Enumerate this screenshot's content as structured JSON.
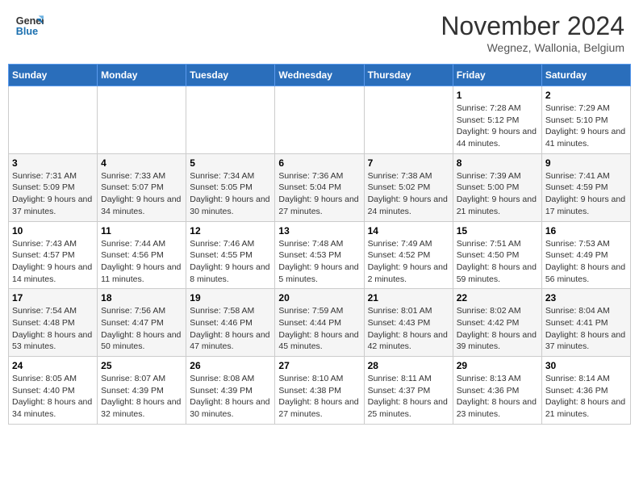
{
  "logo": {
    "line1": "General",
    "line2": "Blue"
  },
  "title": "November 2024",
  "location": "Wegnez, Wallonia, Belgium",
  "days_of_week": [
    "Sunday",
    "Monday",
    "Tuesday",
    "Wednesday",
    "Thursday",
    "Friday",
    "Saturday"
  ],
  "weeks": [
    [
      {
        "day": "",
        "info": ""
      },
      {
        "day": "",
        "info": ""
      },
      {
        "day": "",
        "info": ""
      },
      {
        "day": "",
        "info": ""
      },
      {
        "day": "",
        "info": ""
      },
      {
        "day": "1",
        "info": "Sunrise: 7:28 AM\nSunset: 5:12 PM\nDaylight: 9 hours and 44 minutes."
      },
      {
        "day": "2",
        "info": "Sunrise: 7:29 AM\nSunset: 5:10 PM\nDaylight: 9 hours and 41 minutes."
      }
    ],
    [
      {
        "day": "3",
        "info": "Sunrise: 7:31 AM\nSunset: 5:09 PM\nDaylight: 9 hours and 37 minutes."
      },
      {
        "day": "4",
        "info": "Sunrise: 7:33 AM\nSunset: 5:07 PM\nDaylight: 9 hours and 34 minutes."
      },
      {
        "day": "5",
        "info": "Sunrise: 7:34 AM\nSunset: 5:05 PM\nDaylight: 9 hours and 30 minutes."
      },
      {
        "day": "6",
        "info": "Sunrise: 7:36 AM\nSunset: 5:04 PM\nDaylight: 9 hours and 27 minutes."
      },
      {
        "day": "7",
        "info": "Sunrise: 7:38 AM\nSunset: 5:02 PM\nDaylight: 9 hours and 24 minutes."
      },
      {
        "day": "8",
        "info": "Sunrise: 7:39 AM\nSunset: 5:00 PM\nDaylight: 9 hours and 21 minutes."
      },
      {
        "day": "9",
        "info": "Sunrise: 7:41 AM\nSunset: 4:59 PM\nDaylight: 9 hours and 17 minutes."
      }
    ],
    [
      {
        "day": "10",
        "info": "Sunrise: 7:43 AM\nSunset: 4:57 PM\nDaylight: 9 hours and 14 minutes."
      },
      {
        "day": "11",
        "info": "Sunrise: 7:44 AM\nSunset: 4:56 PM\nDaylight: 9 hours and 11 minutes."
      },
      {
        "day": "12",
        "info": "Sunrise: 7:46 AM\nSunset: 4:55 PM\nDaylight: 9 hours and 8 minutes."
      },
      {
        "day": "13",
        "info": "Sunrise: 7:48 AM\nSunset: 4:53 PM\nDaylight: 9 hours and 5 minutes."
      },
      {
        "day": "14",
        "info": "Sunrise: 7:49 AM\nSunset: 4:52 PM\nDaylight: 9 hours and 2 minutes."
      },
      {
        "day": "15",
        "info": "Sunrise: 7:51 AM\nSunset: 4:50 PM\nDaylight: 8 hours and 59 minutes."
      },
      {
        "day": "16",
        "info": "Sunrise: 7:53 AM\nSunset: 4:49 PM\nDaylight: 8 hours and 56 minutes."
      }
    ],
    [
      {
        "day": "17",
        "info": "Sunrise: 7:54 AM\nSunset: 4:48 PM\nDaylight: 8 hours and 53 minutes."
      },
      {
        "day": "18",
        "info": "Sunrise: 7:56 AM\nSunset: 4:47 PM\nDaylight: 8 hours and 50 minutes."
      },
      {
        "day": "19",
        "info": "Sunrise: 7:58 AM\nSunset: 4:46 PM\nDaylight: 8 hours and 47 minutes."
      },
      {
        "day": "20",
        "info": "Sunrise: 7:59 AM\nSunset: 4:44 PM\nDaylight: 8 hours and 45 minutes."
      },
      {
        "day": "21",
        "info": "Sunrise: 8:01 AM\nSunset: 4:43 PM\nDaylight: 8 hours and 42 minutes."
      },
      {
        "day": "22",
        "info": "Sunrise: 8:02 AM\nSunset: 4:42 PM\nDaylight: 8 hours and 39 minutes."
      },
      {
        "day": "23",
        "info": "Sunrise: 8:04 AM\nSunset: 4:41 PM\nDaylight: 8 hours and 37 minutes."
      }
    ],
    [
      {
        "day": "24",
        "info": "Sunrise: 8:05 AM\nSunset: 4:40 PM\nDaylight: 8 hours and 34 minutes."
      },
      {
        "day": "25",
        "info": "Sunrise: 8:07 AM\nSunset: 4:39 PM\nDaylight: 8 hours and 32 minutes."
      },
      {
        "day": "26",
        "info": "Sunrise: 8:08 AM\nSunset: 4:39 PM\nDaylight: 8 hours and 30 minutes."
      },
      {
        "day": "27",
        "info": "Sunrise: 8:10 AM\nSunset: 4:38 PM\nDaylight: 8 hours and 27 minutes."
      },
      {
        "day": "28",
        "info": "Sunrise: 8:11 AM\nSunset: 4:37 PM\nDaylight: 8 hours and 25 minutes."
      },
      {
        "day": "29",
        "info": "Sunrise: 8:13 AM\nSunset: 4:36 PM\nDaylight: 8 hours and 23 minutes."
      },
      {
        "day": "30",
        "info": "Sunrise: 8:14 AM\nSunset: 4:36 PM\nDaylight: 8 hours and 21 minutes."
      }
    ]
  ]
}
